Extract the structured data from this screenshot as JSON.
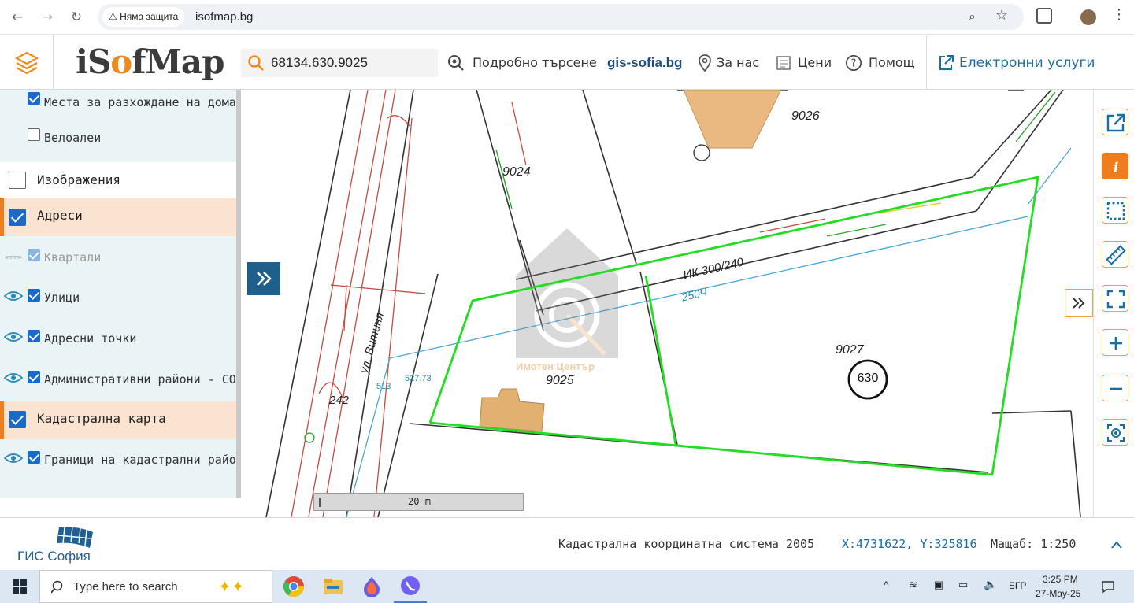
{
  "browser": {
    "security_label": "Няма защита",
    "url": "isofmap.bg"
  },
  "header": {
    "logo_prefix": "iS",
    "logo_o": "o",
    "logo_suffix": "fMap",
    "search_value": "68134.630.9025",
    "advanced_search": "Подробно търсене",
    "gis_link": "gis-sofia.bg",
    "about": "За нас",
    "prices": "Цени",
    "help": "Помощ",
    "eservices": "Електронни услуги"
  },
  "layers": [
    {
      "label": "Места за разхождане на домаш",
      "checked": true,
      "level": "sub"
    },
    {
      "label": "Велоалеи",
      "checked": false,
      "level": "sub"
    },
    {
      "label": "Изображения",
      "checked": false,
      "level": "group"
    },
    {
      "label": "Адреси",
      "checked": true,
      "level": "group",
      "highlight": true
    },
    {
      "label": "Квартали",
      "checked": true,
      "level": "sub",
      "dim": true
    },
    {
      "label": "Улици",
      "checked": true,
      "level": "sub",
      "eye": true
    },
    {
      "label": "Адресни точки",
      "checked": true,
      "level": "sub",
      "eye": true
    },
    {
      "label": "Административни райони - СО",
      "checked": true,
      "level": "sub",
      "eye": true
    },
    {
      "label": "Кадастрална карта",
      "checked": true,
      "level": "group",
      "highlight": true
    },
    {
      "label": "Граници на кадастрални район",
      "checked": true,
      "level": "sub",
      "eye": true
    }
  ],
  "map": {
    "parcels": [
      "9026",
      "9024",
      "9025",
      "9027",
      "242"
    ],
    "property_number": "630",
    "street_label": "ул. Витиня",
    "pipe_label": "ИК 300/240",
    "pipe_label_2": "250Ч",
    "elevation": "527.73",
    "point_label": "513",
    "watermark": "Имотен Център",
    "scale_bar": "20 m"
  },
  "footer": {
    "brand": "ГИС София",
    "crs": "Кадастрална координатна система 2005",
    "coords": "X:4731622, Y:325816",
    "scale": "Мащаб: 1:250"
  },
  "taskbar": {
    "search_placeholder": "Type here to search",
    "lang": "БГР",
    "time": "3:25 PM",
    "date": "27-May-25"
  },
  "colors": {
    "brand_orange": "#f07d1c",
    "panel_blue": "#1f5f8b",
    "parcel_green": "#22dd22",
    "highlight_row": "#fbe3d2"
  }
}
